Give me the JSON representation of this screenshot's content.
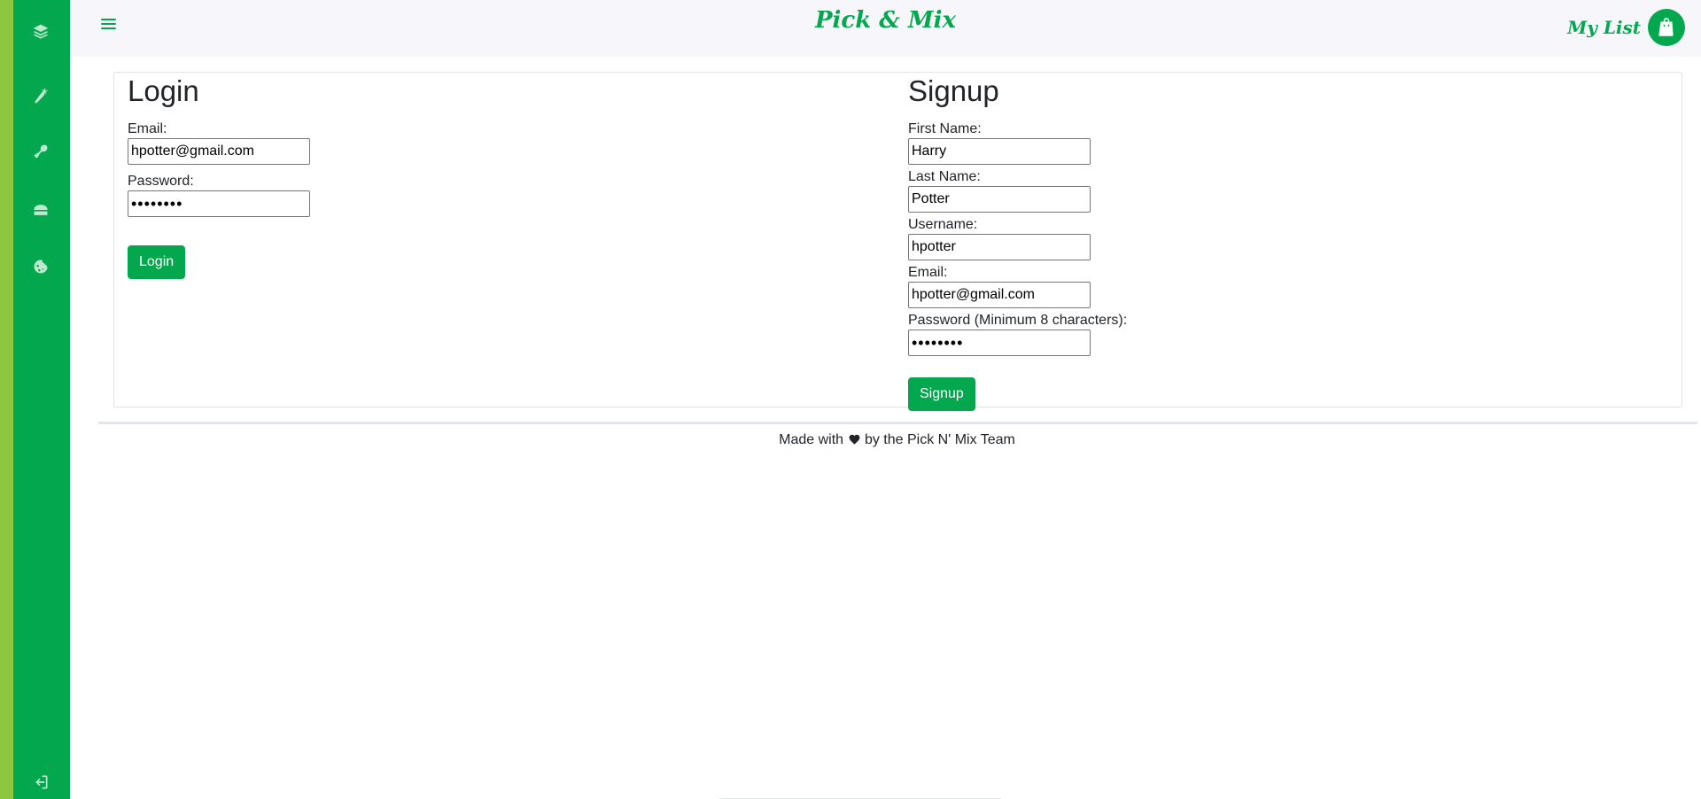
{
  "app": {
    "brand": "Pick & Mix",
    "my_list_label": "My List"
  },
  "sidebar": {
    "items": [
      {
        "icon": "layers-icon"
      },
      {
        "icon": "carrot-icon"
      },
      {
        "icon": "meat-leg-icon"
      },
      {
        "icon": "bread-icon"
      },
      {
        "icon": "cookie-icon"
      }
    ],
    "logout_icon": "sign-in-icon"
  },
  "login": {
    "title": "Login",
    "email_label": "Email:",
    "email_value": "hpotter@gmail.com",
    "password_label": "Password:",
    "password_value": "hpotter1",
    "button_label": "Login"
  },
  "signup": {
    "title": "Signup",
    "first_name_label": "First Name:",
    "first_name_value": "Harry",
    "last_name_label": "Last Name:",
    "last_name_value": "Potter",
    "username_label": "Username:",
    "username_value": "hpotter",
    "email_label": "Email:",
    "email_value": "hpotter@gmail.com",
    "password_label": "Password (Minimum 8 characters):",
    "password_value": "hpotter1",
    "button_label": "Signup"
  },
  "footer": {
    "text_before": "Made with",
    "text_after": "by the Pick N' Mix Team"
  },
  "colors": {
    "primary": "#03a84e",
    "sidebar_accent": "#8dc63f",
    "navbar_bg": "#f7f7fb"
  }
}
